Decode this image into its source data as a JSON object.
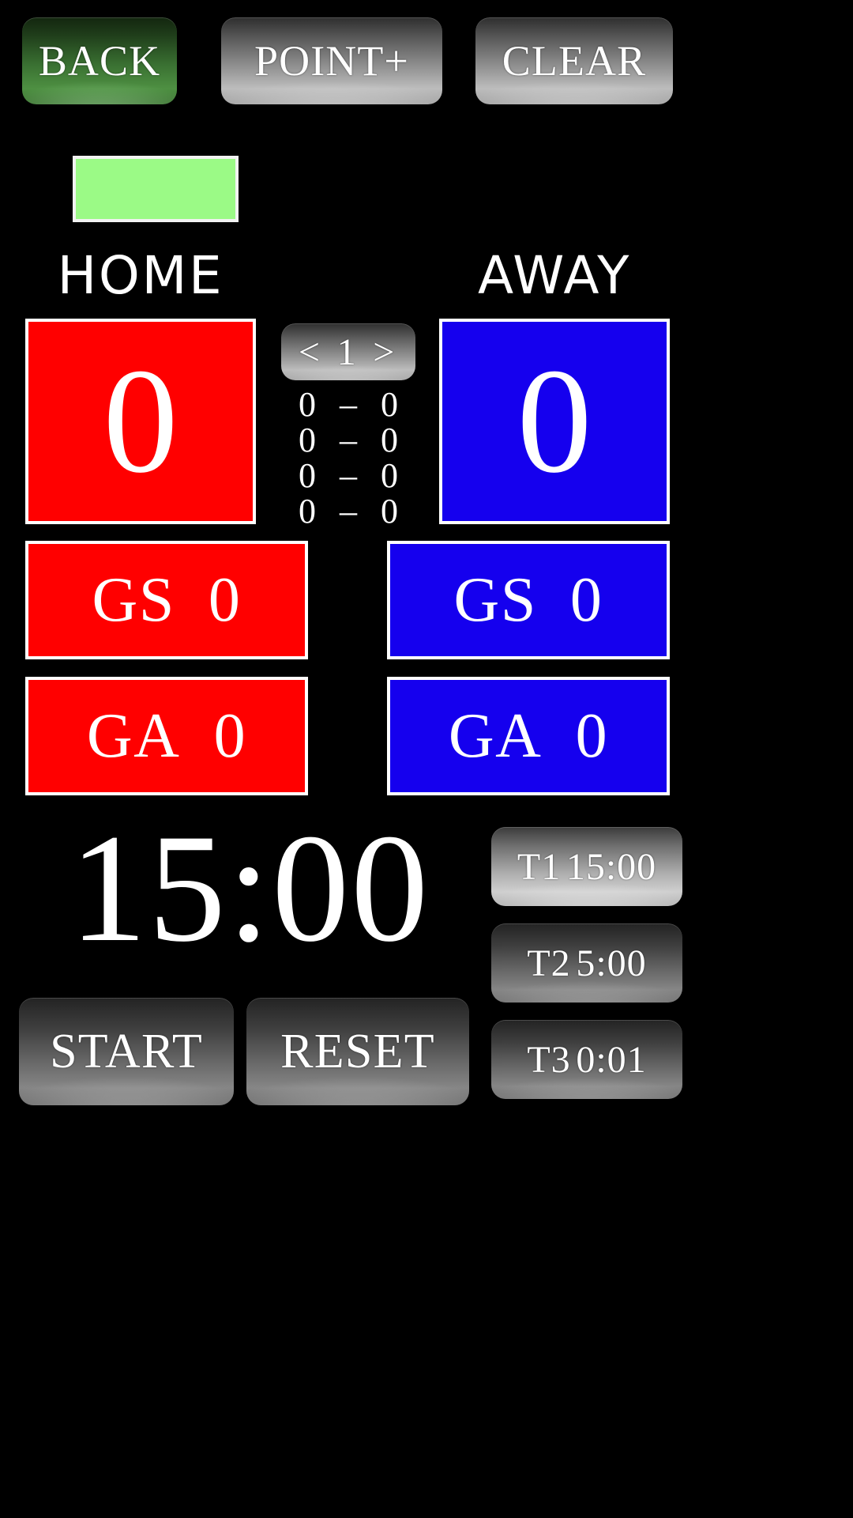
{
  "toolbar": {
    "back_label": "BACK",
    "point_label": "POINT+",
    "clear_label": "CLEAR"
  },
  "colors": {
    "home": "#ff0000",
    "away": "#1500ee",
    "possession_indicator": "#9bfa86",
    "background": "#000000",
    "text": "#ffffff"
  },
  "teams": {
    "home": {
      "label": "HOME",
      "score": "0",
      "goals_scored_label": "GS",
      "goals_scored": "0",
      "goals_against_label": "GA",
      "goals_against": "0"
    },
    "away": {
      "label": "AWAY",
      "score": "0",
      "goals_scored_label": "GS",
      "goals_scored": "0",
      "goals_against_label": "GA",
      "goals_against": "0"
    }
  },
  "period": {
    "prev_arrow": "<",
    "current": "1",
    "next_arrow": ">",
    "selector_text": "< 1 >",
    "rows": [
      {
        "home": "0",
        "dash": "–",
        "away": "0"
      },
      {
        "home": "0",
        "dash": "–",
        "away": "0"
      },
      {
        "home": "0",
        "dash": "–",
        "away": "0"
      },
      {
        "home": "0",
        "dash": "–",
        "away": "0"
      }
    ]
  },
  "clock": {
    "display": "15:00",
    "start_label": "START",
    "reset_label": "RESET"
  },
  "presets": [
    {
      "name": "T1",
      "value": "15:00",
      "selected": true
    },
    {
      "name": "T2",
      "value": "5:00",
      "selected": false
    },
    {
      "name": "T3",
      "value": "0:01",
      "selected": false
    }
  ]
}
